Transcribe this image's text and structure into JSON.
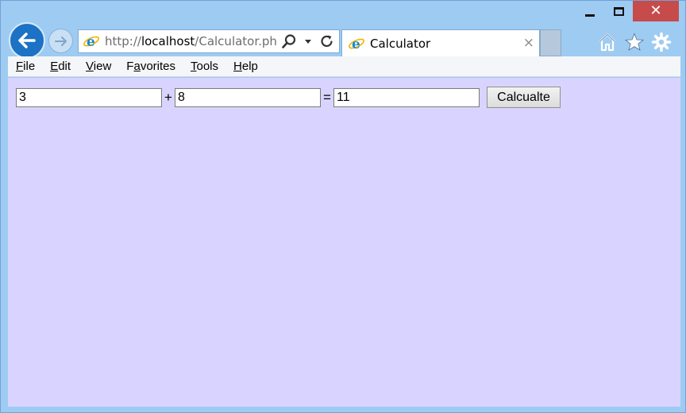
{
  "window": {
    "minimize_glyph": "",
    "close_glyph": "✕"
  },
  "nav": {
    "url_prefix": "http://",
    "url_host": "localhost",
    "url_path": "/Calculator.php?>"
  },
  "tab": {
    "title": "Calculator",
    "close_glyph": "×"
  },
  "menu": {
    "items": [
      {
        "accel": "F",
        "rest": "ile"
      },
      {
        "accel": "E",
        "rest": "dit"
      },
      {
        "accel": "V",
        "rest": "iew"
      },
      {
        "pre": "F",
        "accel": "a",
        "rest": "vorites"
      },
      {
        "accel": "T",
        "rest": "ools"
      },
      {
        "accel": "H",
        "rest": "elp"
      }
    ]
  },
  "calculator": {
    "operand1": "3",
    "operator": "+",
    "operand2": "8",
    "equals": "=",
    "result": "11",
    "button_label": "Calcualte"
  },
  "colors": {
    "content_bg": "#d8d4ff",
    "chrome_bg": "#9ecbf2",
    "back_button": "#1c72c4",
    "close_button": "#c74b4b"
  },
  "icons": {
    "back": "arrow-left-icon",
    "forward": "arrow-right-icon",
    "site": "ie-logo-icon",
    "search": "search-icon",
    "dropdown": "chevron-down-icon",
    "refresh": "refresh-icon",
    "home": "home-icon",
    "favorites": "star-icon",
    "tools": "gear-icon"
  }
}
